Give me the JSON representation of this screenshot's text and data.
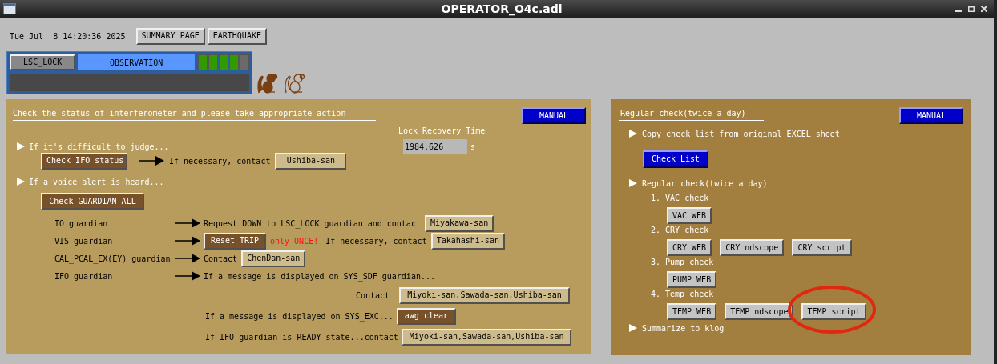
{
  "window": {
    "title": "OPERATOR_O4c.adl"
  },
  "header": {
    "datetime": "Tue Jul  8 14:20:36 2025",
    "buttons": [
      "SUMMARY PAGE",
      "EARTHQUAKE"
    ]
  },
  "status": {
    "guardian": "LSC_LOCK",
    "state": "OBSERVATION",
    "indicators": [
      {
        "on": true
      },
      {
        "on": true
      },
      {
        "on": true
      },
      {
        "on": true
      },
      {
        "on": false
      }
    ]
  },
  "ifo_panel": {
    "title": "Check the status of interferometer and please take appropriate action",
    "manual_button": "MANUAL",
    "lock_recovery": {
      "label": "Lock Recovery Time",
      "value": "1984.626",
      "unit": "s"
    },
    "step_1": {
      "text": "If it's difficult to judge...",
      "button": "Check IFO status",
      "note": "If necessary, contact",
      "contact": "Ushiba-san"
    },
    "step_2": {
      "text": "If a voice alert is heard...",
      "button": "Check GUARDIAN ALL"
    },
    "guardians": [
      {
        "name": "IO guardian",
        "items": [
          {
            "kind": "text",
            "text": "Request DOWN to LSC_LOCK guardian and contact"
          },
          {
            "kind": "contact",
            "text": "Miyakawa-san"
          }
        ]
      },
      {
        "name": "VIS guardian",
        "items": [
          {
            "kind": "action",
            "text": "Reset TRIP"
          },
          {
            "kind": "warning",
            "text": "only ONCE!"
          },
          {
            "kind": "text",
            "text": "If necessary, contact"
          },
          {
            "kind": "contact",
            "text": "Takahashi-san"
          }
        ]
      },
      {
        "name": "CAL_PCAL_EX(EY) guardian",
        "items": [
          {
            "kind": "text",
            "text": "Contact"
          },
          {
            "kind": "contact",
            "text": "ChenDan-san"
          }
        ]
      },
      {
        "name": "IFO guardian",
        "items": [
          {
            "kind": "text",
            "text": "If a message is displayed on SYS_SDF guardian..."
          }
        ]
      }
    ],
    "followups": [
      {
        "kind": "contact_line",
        "lead": "Contact",
        "button": {
          "kind": "contact",
          "text": "Miyoki-san,Sawada-san,Ushiba-san"
        }
      },
      {
        "kind": "condition",
        "lead": "If a message is displayed on SYS_EXC...",
        "button": {
          "kind": "action",
          "text": "awg clear"
        }
      },
      {
        "kind": "condition",
        "lead": "If IFO guardian is READY state...contact",
        "button": {
          "kind": "contact",
          "text": "Miyoki-san,Sawada-san,Ushiba-san"
        }
      }
    ]
  },
  "regular_panel": {
    "title": "Regular check(twice a day)",
    "manual_button": "MANUAL",
    "copy_step": {
      "text": "Copy check list from original EXCEL sheet",
      "button": "Check List"
    },
    "check_step": {
      "text": "Regular check(twice a day)",
      "checks": [
        {
          "label": "1. VAC check",
          "buttons": [
            {
              "label": "VAC WEB",
              "circled": false
            }
          ]
        },
        {
          "label": "2. CRY check",
          "buttons": [
            {
              "label": "CRY WEB",
              "circled": false
            },
            {
              "label": "CRY ndscope",
              "circled": false
            },
            {
              "label": "CRY script",
              "circled": false
            }
          ]
        },
        {
          "label": "3. Pump check",
          "buttons": [
            {
              "label": "PUMP WEB",
              "circled": false
            }
          ]
        },
        {
          "label": "4. Temp check",
          "buttons": [
            {
              "label": "TEMP WEB",
              "circled": false
            },
            {
              "label": "TEMP ndscope",
              "circled": false
            },
            {
              "label": "TEMP script",
              "circled": true
            }
          ]
        }
      ]
    },
    "final_step": {
      "text": "Summarize to klog"
    }
  }
}
